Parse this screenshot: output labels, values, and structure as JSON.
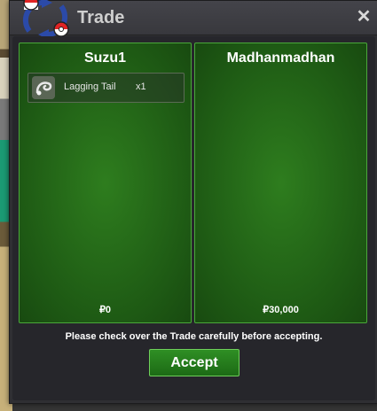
{
  "window": {
    "title": "Trade",
    "close_label": "✕"
  },
  "left_panel": {
    "player_name": "Suzu1",
    "items": [
      {
        "name": "Lagging Tail",
        "quantity": "x1",
        "icon": "lagging-tail-icon"
      }
    ],
    "money": "₽0"
  },
  "right_panel": {
    "player_name": "Madhanmadhan",
    "items": [],
    "money": "₽30,000"
  },
  "notice": "Please check over the Trade carefully before accepting.",
  "accept_label": "Accept",
  "colors": {
    "panel_green": "#1e5a14",
    "panel_border": "#4aa83a",
    "button_green": "#2f8f24"
  }
}
